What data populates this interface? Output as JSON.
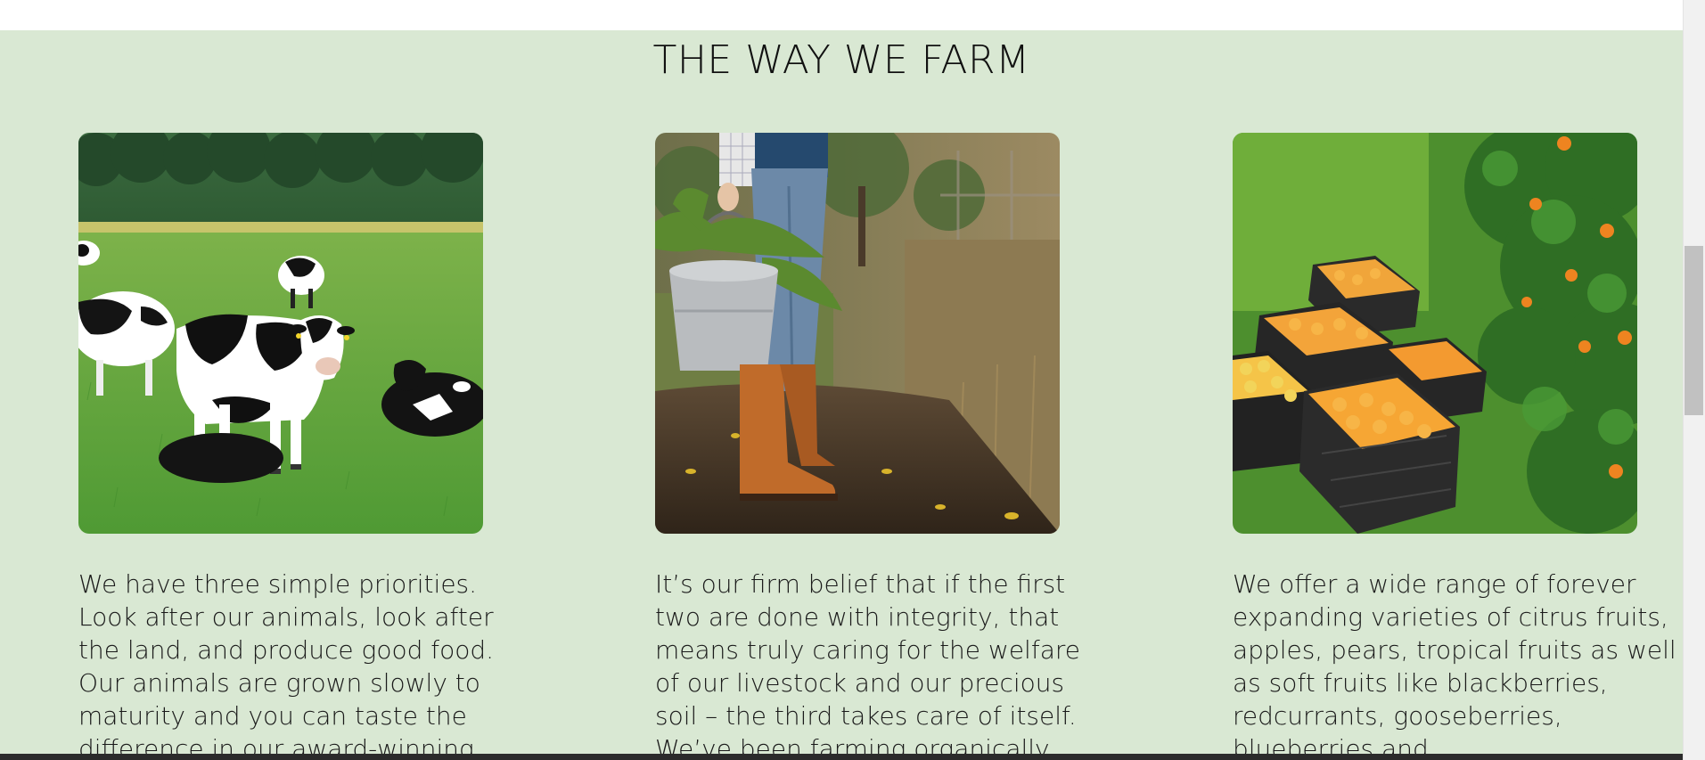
{
  "section": {
    "title": "THE WAY WE FARM"
  },
  "cards": [
    {
      "image_alt": "Holstein cows grazing in a green pasture",
      "text": "We have three simple priorities. Look after our animals, look after the land, and produce good food. Our animals are grown slowly to maturity and you can taste the difference in our award-winning"
    },
    {
      "image_alt": "Farmer holding a metal bucket of fresh carrots, wearing leather boots",
      "text": "It’s our firm belief that if the first two are done with integrity, that means truly caring for the welfare of our livestock and our precious soil – the third takes care of itself. We’ve been farming organically"
    },
    {
      "image_alt": "Crates of freshly picked oranges beside an orange tree",
      "text": "We offer a wide range of forever expanding varieties of citrus fruits, apples, pears, tropical fruits as well as soft fruits like blackberries, redcurrants, gooseberries, blueberries and"
    }
  ],
  "colors": {
    "section_background": "#d9e8d3",
    "text": "#1a1a1a"
  }
}
